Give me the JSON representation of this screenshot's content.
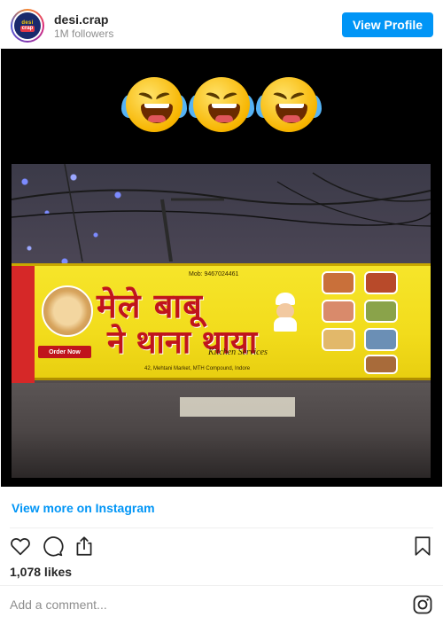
{
  "header": {
    "username": "desi.crap",
    "followers": "1M followers",
    "view_profile_label": "View Profile",
    "avatar_text_top": "desi",
    "avatar_text_bottom": "crap"
  },
  "media": {
    "emojis": [
      "face-with-tears-of-joy",
      "face-with-tears-of-joy",
      "face-with-tears-of-joy"
    ],
    "sign": {
      "mobile": "Mob: 9467024461",
      "title_line1": "मेले बाबू",
      "title_line2": "ने थाना थाया",
      "subtitle": "Kitchen Services",
      "address": "42, Mehtani Market, MTH Compound, Indore",
      "order_now": "Order Now"
    }
  },
  "footer": {
    "more_link": "View more on Instagram",
    "likes": "1,078 likes",
    "comment_placeholder": "Add a comment...",
    "icons": [
      "heart-icon",
      "comment-icon",
      "share-icon",
      "bookmark-icon",
      "instagram-icon"
    ]
  },
  "colors": {
    "accent": "#0095f6",
    "text": "#262626",
    "muted": "#8e8e8e",
    "sign_yellow": "#f6e52a",
    "sign_red": "#c0141c"
  }
}
